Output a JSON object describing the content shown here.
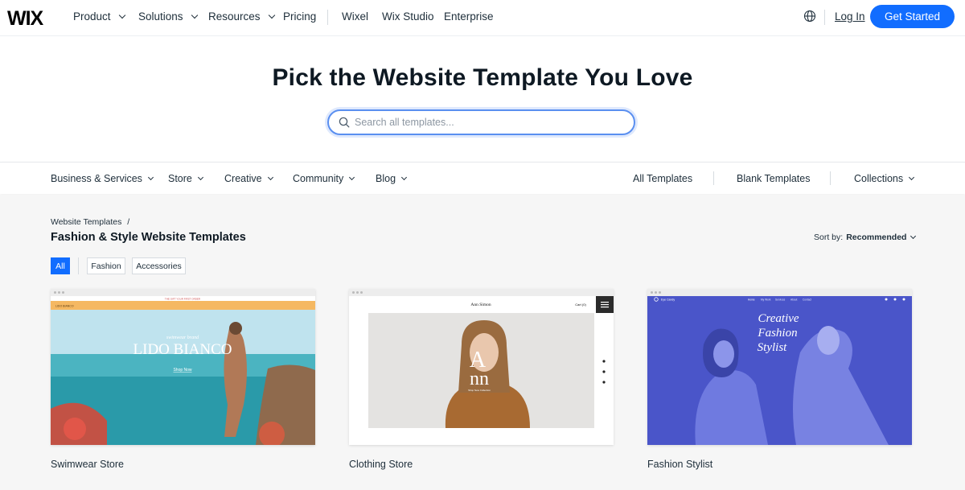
{
  "brand": {
    "logo": "WIX",
    "accent": "#116dff"
  },
  "nav": {
    "items": [
      {
        "label": "Product",
        "dropdown": true
      },
      {
        "label": "Solutions",
        "dropdown": true
      },
      {
        "label": "Resources",
        "dropdown": true
      },
      {
        "label": "Pricing",
        "dropdown": false
      },
      {
        "label": "Wixel",
        "dropdown": false
      },
      {
        "label": "Wix Studio",
        "dropdown": false
      },
      {
        "label": "Enterprise",
        "dropdown": false
      }
    ],
    "globe_icon": "globe-icon",
    "login": "Log In",
    "cta": "Get Started"
  },
  "hero": {
    "title": "Pick the Website Template You Love",
    "search_placeholder": "Search all templates..."
  },
  "categories": {
    "left": [
      {
        "label": "Business & Services"
      },
      {
        "label": "Store"
      },
      {
        "label": "Creative"
      },
      {
        "label": "Community"
      },
      {
        "label": "Blog"
      }
    ],
    "right": [
      {
        "label": "All Templates"
      },
      {
        "label": "Blank Templates"
      },
      {
        "label": "Collections"
      }
    ]
  },
  "listing": {
    "breadcrumb": "Website Templates",
    "breadcrumb_sep": "/",
    "title": "Fashion & Style Website Templates",
    "sort_label": "Sort by:",
    "sort_value": "Recommended",
    "filters": [
      "All",
      "Fashion",
      "Accessories"
    ],
    "active_filter": "All"
  },
  "templates": [
    {
      "name": "Swimwear Store",
      "preview": {
        "promo": "THE GIFT YOUR FIRST ORDER",
        "brand": "LIDO BIANCO",
        "kicker": "swimwear brand",
        "headline": "LIDO BIANCO",
        "cta": "Shop Now",
        "topbar_color": "#f5b862"
      }
    },
    {
      "name": "Clothing Store",
      "preview": {
        "brand": "Ann Simon",
        "cart": "Cart (0)",
        "monogram_top": "A",
        "monogram_bottom": "nn",
        "tagline": "Shop New Collection"
      }
    },
    {
      "name": "Fashion Stylist",
      "preview": {
        "brand": "Eye Candy",
        "menu": [
          "Home",
          "My Work",
          "Services",
          "About",
          "Contact"
        ],
        "headline_lines": [
          "Creative",
          "Fashion",
          "Stylist"
        ],
        "bg_color": "#4a55c9"
      }
    }
  ]
}
